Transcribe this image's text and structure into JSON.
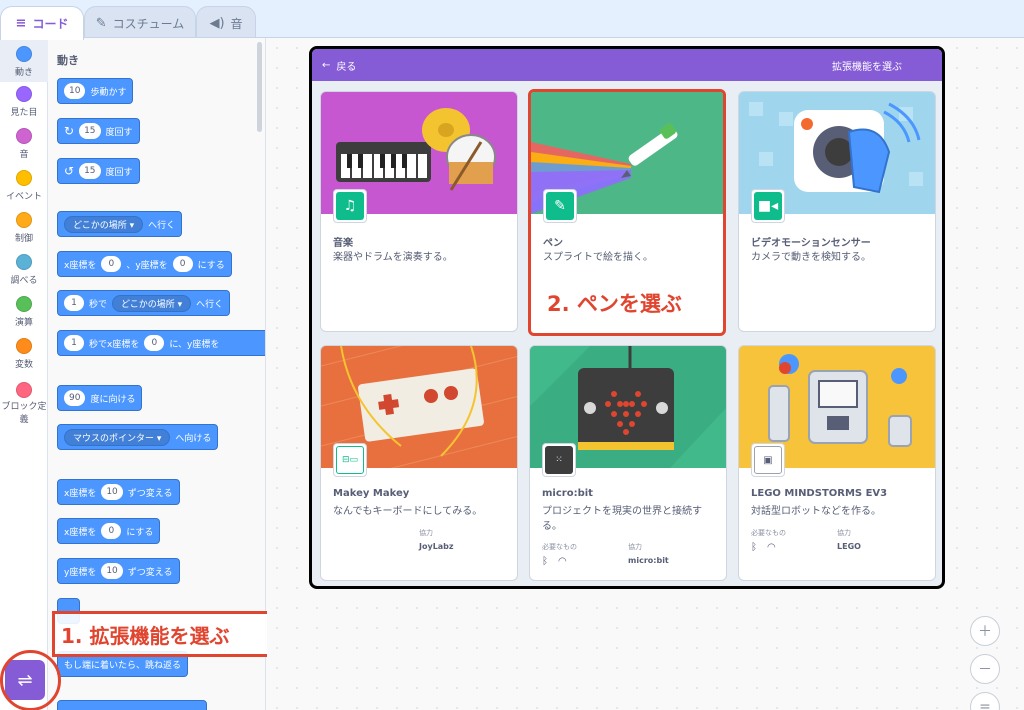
{
  "tabs": [
    {
      "label": "コード",
      "icon": "code-icon"
    },
    {
      "label": "コスチューム",
      "icon": "brush-icon"
    },
    {
      "label": "音",
      "icon": "speaker-icon"
    }
  ],
  "categories": [
    {
      "label": "動き",
      "color": "#4c97ff"
    },
    {
      "label": "見た目",
      "color": "#9966ff"
    },
    {
      "label": "音",
      "color": "#cf63cf"
    },
    {
      "label": "イベント",
      "color": "#ffbf00"
    },
    {
      "label": "制御",
      "color": "#ffab19"
    },
    {
      "label": "調べる",
      "color": "#5cb1d6"
    },
    {
      "label": "演算",
      "color": "#59c059"
    },
    {
      "label": "変数",
      "color": "#ff8c1a"
    },
    {
      "label": "ブロック定義",
      "color": "#ff6680"
    }
  ],
  "palette": {
    "title": "動き",
    "blocks": {
      "move_num": "10",
      "move_label": "歩動かす",
      "turn_right_num": "15",
      "turn_right_label": "度回す",
      "turn_left_num": "15",
      "turn_left_label": "度回す",
      "goto_drop": "どこかの場所 ▾",
      "goto_label": "へ行く",
      "gotoxy_x_label": "x座標を",
      "gotoxy_x": "0",
      "gotoxy_y_label": "、y座標を",
      "gotoxy_y": "0",
      "gotoxy_end": "にする",
      "glide_num": "1",
      "glide_mid": "秒で",
      "glide_drop": "どこかの場所 ▾",
      "glide_label": "へ行く",
      "glidexy_num": "1",
      "glidexy_mid": "秒でx座標を",
      "glidexy_x": "0",
      "glidexy_end": "に、y座標を",
      "point_num": "90",
      "point_label": "度に向ける",
      "towards_drop": "マウスのポインター ▾",
      "towards_label": "へ向ける",
      "changex_label": "x座標を",
      "changex_num": "10",
      "changex_end": "ずつ変える",
      "setx_label": "x座標を",
      "setx_num": "0",
      "setx_end": "にする",
      "changey_label": "y座標を",
      "changey_num": "10",
      "changey_end": "ずつ変える",
      "bounce_label": "もし端に着いたら、跳ね返る"
    }
  },
  "annotations": {
    "step1": "1. 拡張機能を選ぶ",
    "step2": "2. ペンを選ぶ"
  },
  "library": {
    "back_label": "戻る",
    "title": "拡張機能を選ぶ",
    "extensions": [
      {
        "name": "音楽",
        "description": "楽器やドラムを演奏する。",
        "bg": "#c757d1",
        "badge_color": "#0fbd8c",
        "icon": "music-notes-icon"
      },
      {
        "name": "ペン",
        "description": "スプライトで絵を描く。",
        "bg": "#4eb788",
        "badge_color": "#0fbd8c",
        "icon": "pen-icon"
      },
      {
        "name": "ビデオモーションセンサー",
        "description": "カメラで動きを検知する。",
        "bg": "#8fd0ea",
        "badge_color": "#0fbd8c",
        "icon": "video-camera-icon"
      },
      {
        "name": "Makey Makey",
        "description": "なんでもキーボードにしてみる。",
        "bg": "#e8703f",
        "badge_color": "#0fbd8c",
        "icon": "makey-icon",
        "collab_label": "協力",
        "collab": "JoyLabz"
      },
      {
        "name": "micro:bit",
        "description": "プロジェクトを現実の世界と接続する。",
        "bg": "#36a37a",
        "badge_color": "#0fbd8c",
        "icon": "microbit-icon",
        "req_label": "必要なもの",
        "collab_label": "協力",
        "collab": "micro:bit"
      },
      {
        "name": "LEGO MINDSTORMS EV3",
        "description": "対話型ロボットなどを作る。",
        "bg": "#f7c33a",
        "badge_color": "#0fbd8c",
        "icon": "ev3-icon",
        "req_label": "必要なもの",
        "collab_label": "協力",
        "collab": "LEGO"
      }
    ]
  },
  "zoom": {
    "in": "＋",
    "out": "－",
    "reset": "="
  }
}
